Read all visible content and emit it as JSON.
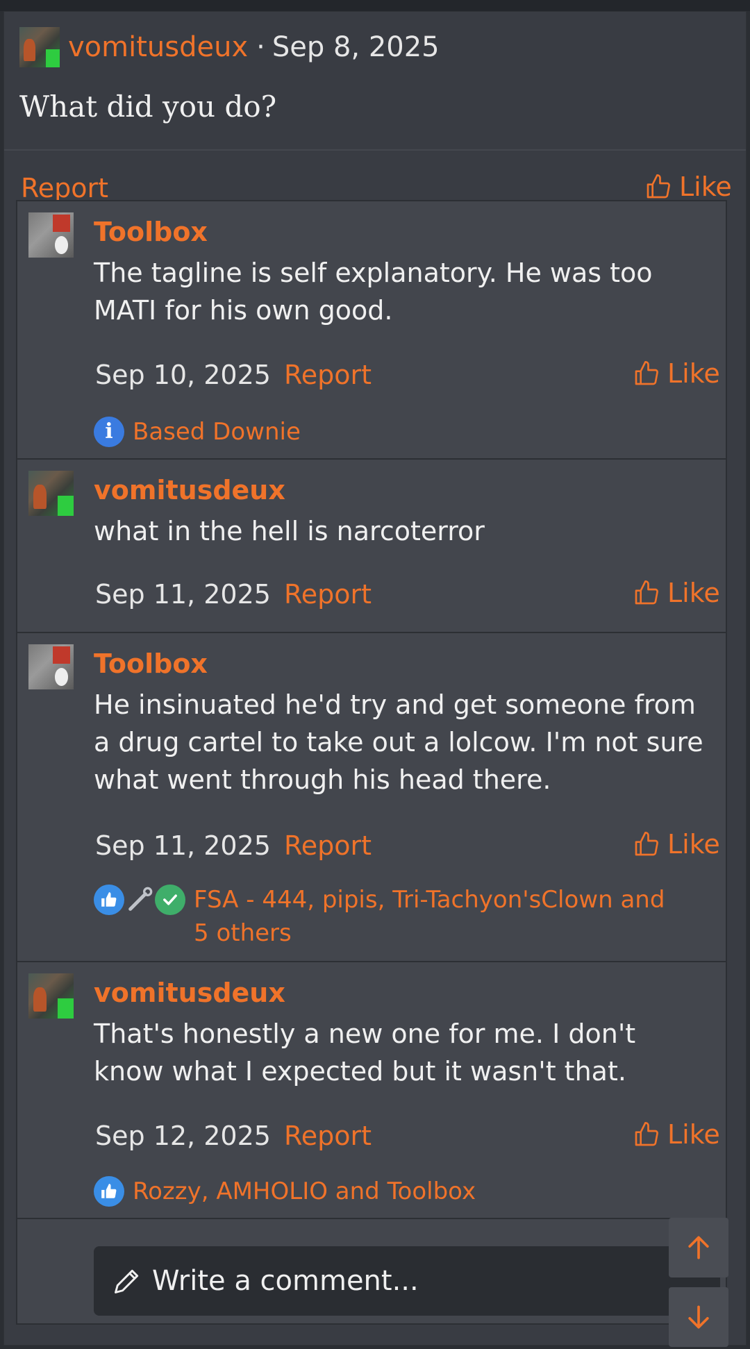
{
  "post": {
    "author": "vomitusdeux",
    "separator": "·",
    "date": "Sep 8, 2025",
    "body": "What did you do?",
    "report_label": "Report",
    "like_label": "Like"
  },
  "comments": [
    {
      "author": "Toolbox",
      "text": "The tagline is self explanatory. He was too MATI for his own good.",
      "date": "Sep 10, 2025",
      "report_label": "Report",
      "like_label": "Like",
      "reactions": {
        "icons": [
          "info-icon"
        ],
        "text": "Based Downie"
      }
    },
    {
      "author": "vomitusdeux",
      "text": "what in the hell is narcoterror",
      "date": "Sep 11, 2025",
      "report_label": "Report",
      "like_label": "Like"
    },
    {
      "author": "Toolbox",
      "text": "He insinuated he'd try and get someone from a drug cartel to take out a lolcow. I'm not sure what went through his head there.",
      "date": "Sep 11, 2025",
      "report_label": "Report",
      "like_label": "Like",
      "reactions": {
        "icons": [
          "thumbs-up-icon",
          "wrench-icon",
          "checkmark-icon"
        ],
        "text": "FSA - 444, pipis, Tri-Tachyon'sClown and 5 others"
      }
    },
    {
      "author": "vomitusdeux",
      "text": "That's honestly a new one for me. I don't know what I expected but it wasn't that.",
      "date": "Sep 12, 2025",
      "report_label": "Report",
      "like_label": "Like",
      "reactions": {
        "icons": [
          "thumbs-up-icon"
        ],
        "text": "Rozzy, AMHOLIO and Toolbox"
      }
    }
  ],
  "composer": {
    "placeholder": "Write a comment..."
  },
  "colors": {
    "accent": "#f0732a",
    "background": "#2b2e33",
    "panel": "#393c43",
    "comment_panel": "#43464d"
  },
  "icons": {
    "like": "thumbs-up-outline-icon",
    "composer": "pencil-icon",
    "scroll_up": "arrow-up-icon",
    "scroll_down": "arrow-down-icon"
  }
}
